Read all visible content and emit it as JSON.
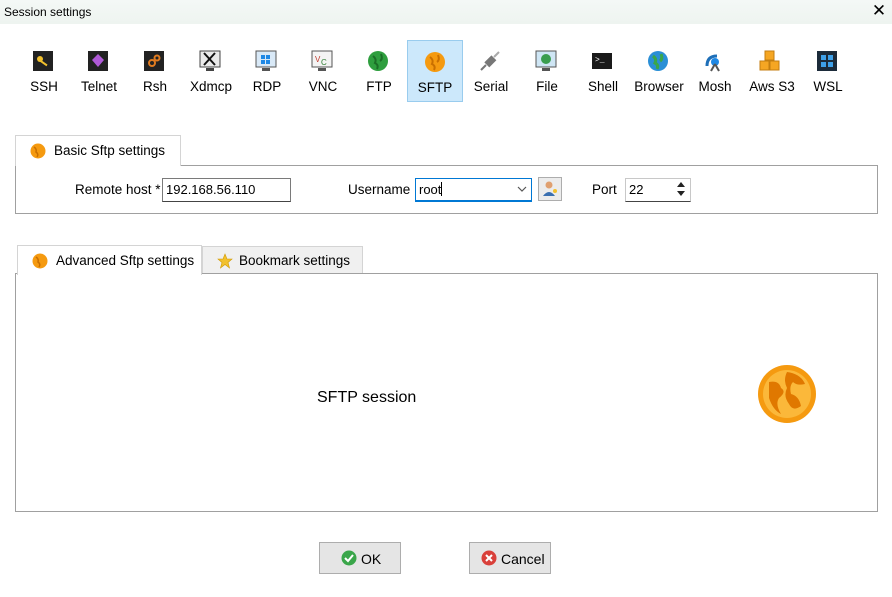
{
  "window": {
    "title": "Session settings"
  },
  "protocols": [
    {
      "label": "SSH",
      "icon": "key-icon"
    },
    {
      "label": "Telnet",
      "icon": "telnet-icon"
    },
    {
      "label": "Rsh",
      "icon": "rsh-icon"
    },
    {
      "label": "Xdmcp",
      "icon": "xdmcp-icon"
    },
    {
      "label": "RDP",
      "icon": "rdp-icon"
    },
    {
      "label": "VNC",
      "icon": "vnc-icon"
    },
    {
      "label": "FTP",
      "icon": "ftp-globe-icon"
    },
    {
      "label": "SFTP",
      "icon": "sftp-globe-icon",
      "selected": true
    },
    {
      "label": "Serial",
      "icon": "serial-plug-icon"
    },
    {
      "label": "File",
      "icon": "file-monitor-icon"
    },
    {
      "label": "Shell",
      "icon": "shell-terminal-icon"
    },
    {
      "label": "Browser",
      "icon": "browser-globe-icon"
    },
    {
      "label": "Mosh",
      "icon": "mosh-antenna-icon"
    },
    {
      "label": "Aws S3",
      "icon": "aws-cubes-icon"
    },
    {
      "label": "WSL",
      "icon": "windows-icon"
    }
  ],
  "basic": {
    "tab_label": "Basic Sftp settings",
    "remote_host_label": "Remote host *",
    "remote_host_value": "192.168.56.110",
    "username_label": "Username",
    "username_value": "root",
    "port_label": "Port",
    "port_value": "22"
  },
  "advanced": {
    "tab_advanced_label": "Advanced Sftp settings",
    "tab_bookmark_label": "Bookmark settings",
    "session_text": "SFTP session"
  },
  "footer": {
    "ok_label": "OK",
    "cancel_label": "Cancel"
  },
  "colors": {
    "accent": "#0078d4",
    "selected_bg": "#cce8fb",
    "sftp_orange": "#f59a10",
    "ok_green": "#3aa64a",
    "cancel_red": "#d9403a"
  }
}
